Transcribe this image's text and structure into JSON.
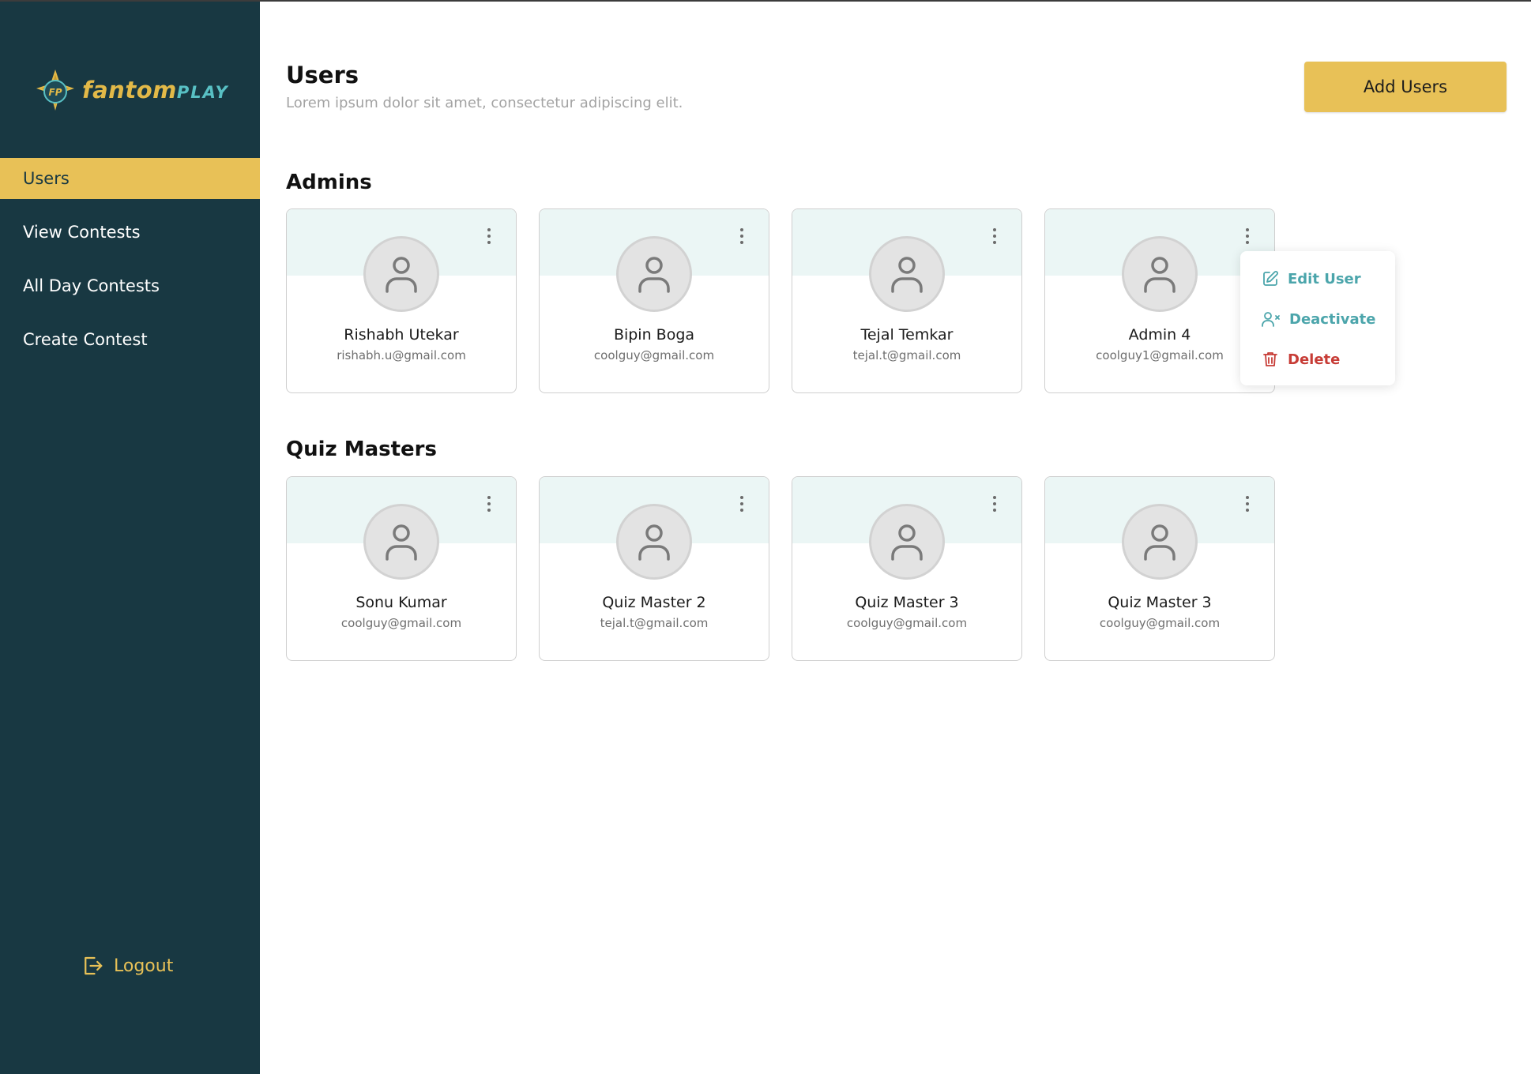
{
  "brand": {
    "logo_main": "fantom",
    "logo_accent": "PLAY",
    "logo_monogram": "FP"
  },
  "sidebar": {
    "items": [
      {
        "label": "Users",
        "active": true
      },
      {
        "label": "View Contests",
        "active": false
      },
      {
        "label": "All Day Contests",
        "active": false
      },
      {
        "label": "Create Contest",
        "active": false
      }
    ],
    "logout_label": "Logout"
  },
  "header": {
    "title": "Users",
    "subtitle": "Lorem ipsum dolor sit amet, consectetur adipiscing elit.",
    "add_button_label": "Add Users"
  },
  "sections": {
    "admins": {
      "title": "Admins",
      "users": [
        {
          "name": "Rishabh Utekar",
          "email": "rishabh.u@gmail.com"
        },
        {
          "name": "Bipin Boga",
          "email": "coolguy@gmail.com"
        },
        {
          "name": "Tejal Temkar",
          "email": "tejal.t@gmail.com"
        },
        {
          "name": "Admin 4",
          "email": "coolguy1@gmail.com"
        }
      ]
    },
    "quiz_masters": {
      "title": "Quiz Masters",
      "users": [
        {
          "name": "Sonu Kumar",
          "email": "coolguy@gmail.com"
        },
        {
          "name": "Quiz Master 2",
          "email": "tejal.t@gmail.com"
        },
        {
          "name": "Quiz Master 3",
          "email": "coolguy@gmail.com"
        },
        {
          "name": "Quiz Master 3",
          "email": "coolguy@gmail.com"
        }
      ]
    }
  },
  "context_menu": {
    "items": [
      {
        "label": "Edit User",
        "icon": "edit-icon"
      },
      {
        "label": "Deactivate",
        "icon": "user-x-icon"
      },
      {
        "label": "Delete",
        "icon": "trash-icon"
      }
    ]
  },
  "colors": {
    "sidebar_bg": "#183842",
    "accent_yellow": "#e8c157",
    "card_header_bg": "#ebf6f5",
    "menu_teal": "#4ba5ab",
    "danger_red": "#c73c36"
  }
}
